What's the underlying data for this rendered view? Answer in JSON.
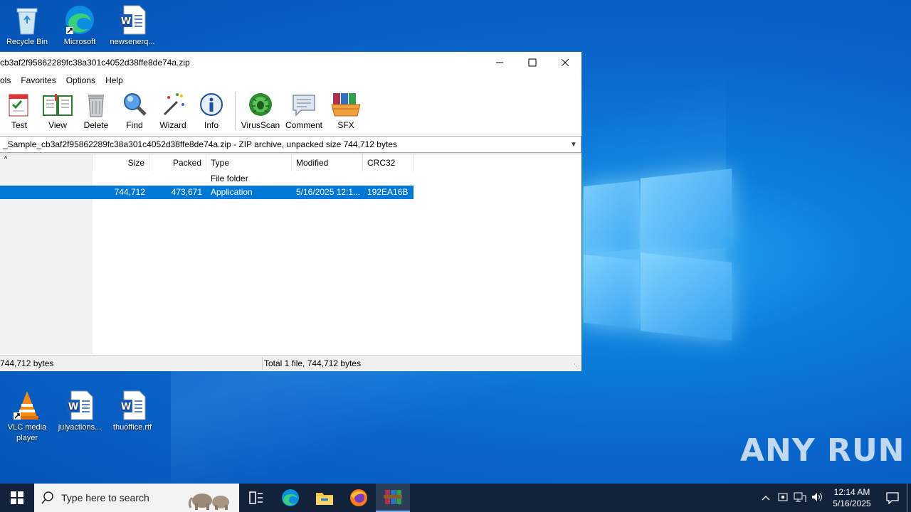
{
  "desktop": {
    "icons": [
      {
        "name": "recycle-bin",
        "label": "Recycle Bin"
      },
      {
        "name": "edge",
        "label": "Microsoft"
      },
      {
        "name": "word-doc",
        "label": "newsenerq..."
      },
      {
        "name": "vlc",
        "label": "VLC media player"
      },
      {
        "name": "word-doc-2",
        "label": "julyactions..."
      },
      {
        "name": "word-doc-3",
        "label": "thuoffice.rtf"
      }
    ]
  },
  "window": {
    "title": "cb3af2f95862289fc38a301c4052d38ffe8de74a.zip",
    "menu": [
      "ols",
      "Favorites",
      "Options",
      "Help"
    ],
    "toolbar": [
      "Test",
      "View",
      "Delete",
      "Find",
      "Wizard",
      "Info",
      "VirusScan",
      "Comment",
      "SFX"
    ],
    "path": "_Sample_cb3af2f95862289fc38a301c4052d38ffe8de74a.zip - ZIP archive, unpacked size 744,712 bytes",
    "columns": {
      "size": "Size",
      "packed": "Packed",
      "type": "Type",
      "modified": "Modified",
      "crc": "CRC32"
    },
    "rows": [
      {
        "size": "",
        "packed": "",
        "type": "File folder",
        "modified": "",
        "crc": ""
      },
      {
        "size": "744,712",
        "packed": "473,671",
        "type": "Application",
        "modified": "5/16/2025 12:1...",
        "crc": "192EA16B"
      }
    ],
    "status_left": "744,712 bytes",
    "status_right": "Total 1 file, 744,712 bytes"
  },
  "taskbar": {
    "search_placeholder": "Type here to search",
    "time": "12:14 AM",
    "date": "5/16/2025"
  },
  "watermark": "ANY RUN"
}
